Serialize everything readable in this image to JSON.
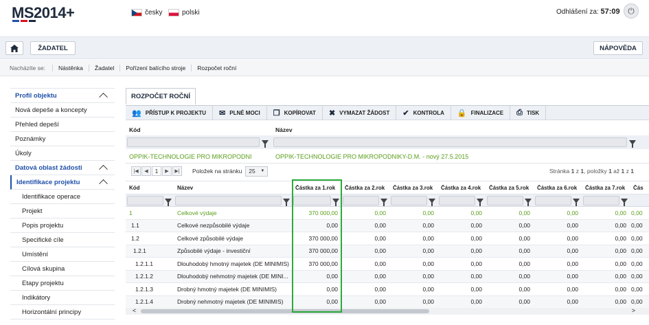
{
  "header": {
    "logo_text": "MS2014+",
    "lang_cz": "česky",
    "lang_pl": "polski",
    "logout_label": "Odhlášení za:",
    "logout_time": "57:09"
  },
  "nav": {
    "home_icon": "home-icon",
    "applicant_button": "ŽADATEL",
    "help_button": "NÁPOVĚDA"
  },
  "breadcrumb": {
    "label": "Nacházíte se:",
    "items": [
      "Nástěnka",
      "Žadatel",
      "Pořízení balícího stroje",
      "Rozpočet roční"
    ]
  },
  "sidebar": {
    "items": [
      {
        "label": "Profil objektu",
        "type": "head"
      },
      {
        "label": "Nová depeše a koncepty",
        "type": "item"
      },
      {
        "label": "Přehled depeší",
        "type": "item"
      },
      {
        "label": "Poznámky",
        "type": "item"
      },
      {
        "label": "Úkoly",
        "type": "item"
      },
      {
        "label": "Datová oblast žádosti",
        "type": "head"
      },
      {
        "label": "Identifikace projektu",
        "type": "head"
      },
      {
        "label": "Identifikace operace",
        "type": "sub"
      },
      {
        "label": "Projekt",
        "type": "sub"
      },
      {
        "label": "Popis projektu",
        "type": "sub"
      },
      {
        "label": "Specifické cíle",
        "type": "sub"
      },
      {
        "label": "Umístění",
        "type": "sub"
      },
      {
        "label": "Cílová skupina",
        "type": "sub"
      },
      {
        "label": "Etapy projektu",
        "type": "sub"
      },
      {
        "label": "Indikátory",
        "type": "sub"
      },
      {
        "label": "Horizontální principy",
        "type": "sub"
      }
    ]
  },
  "main": {
    "tab_label": "ROZPOČET ROČNÍ",
    "toolbar": [
      {
        "label": "PŘÍSTUP K PROJEKTU",
        "icon": "users-icon"
      },
      {
        "label": "PLNÉ MOCI",
        "icon": "mail-icon"
      },
      {
        "label": "KOPÍROVAT",
        "icon": "copy-icon"
      },
      {
        "label": "VYMAZAT ŽÁDOST",
        "icon": "close-icon"
      },
      {
        "label": "KONTROLA",
        "icon": "check-icon"
      },
      {
        "label": "FINALIZACE",
        "icon": "lock-icon"
      },
      {
        "label": "TISK",
        "icon": "print-icon"
      }
    ],
    "grid1": {
      "col_kod": "Kód",
      "col_nazev": "Název",
      "row_kod": "OPPIK-TECHNOLOGIE PRO MIKROPODNI",
      "row_nazev": "OPPIK-TECHNOLOGIE PRO MIKROPODNIKY-D.M. - nový 27.5.2015"
    },
    "pager": {
      "page": "1",
      "per_page_label": "Položek na stránku",
      "per_page": "25",
      "status_page_label": "Stránka",
      "status_page": "1",
      "status_of": "z",
      "status_page_total": "1",
      "status_items_label": "položky",
      "status_items_from": "1",
      "status_items_to_label": "až",
      "status_items_to": "1",
      "status_total_of": "z",
      "status_items_total": "1"
    },
    "table": {
      "columns": [
        "Kód",
        "Název",
        "Částka za 1.rok",
        "Částka za 2.rok",
        "Částka za 3.rok",
        "Částka za 4.rok",
        "Částka za 5.rok",
        "Částka za 6.rok",
        "Částka za 7.rok",
        "Čás"
      ],
      "rows": [
        {
          "kod": "1",
          "nazev": "Celkové výdaje",
          "vals": [
            "370 000,00",
            "0,00",
            "0,00",
            "0,00",
            "0,00",
            "0,00",
            "0,00",
            "0,00"
          ],
          "green": true
        },
        {
          "kod": "1.1",
          "nazev": "Celkové nezpůsobilé výdaje",
          "vals": [
            "0,00",
            "0,00",
            "0,00",
            "0,00",
            "0,00",
            "0,00",
            "0,00",
            "0,00"
          ]
        },
        {
          "kod": "1.2",
          "nazev": "Celkové způsobilé výdaje",
          "vals": [
            "370 000,00",
            "0,00",
            "0,00",
            "0,00",
            "0,00",
            "0,00",
            "0,00",
            "0,00"
          ]
        },
        {
          "kod": "1.2.1",
          "nazev": "Způsobilé výdaje - investiční",
          "vals": [
            "370 000,00",
            "0,00",
            "0,00",
            "0,00",
            "0,00",
            "0,00",
            "0,00",
            "0,00"
          ]
        },
        {
          "kod": "1.2.1.1",
          "nazev": "Dlouhodobý hmotný majetek (DE MINIMIS)",
          "vals": [
            "370 000,00",
            "0,00",
            "0,00",
            "0,00",
            "0,00",
            "0,00",
            "0,00",
            "0,00"
          ]
        },
        {
          "kod": "1.2.1.2",
          "nazev": "Dlouhodobý nehmotný majetek (DE MINI...",
          "vals": [
            "0,00",
            "0,00",
            "0,00",
            "0,00",
            "0,00",
            "0,00",
            "0,00",
            "0,00"
          ]
        },
        {
          "kod": "1.2.1.3",
          "nazev": "Drobný hmotný majetek (DE MINIMIS)",
          "vals": [
            "0,00",
            "0,00",
            "0,00",
            "0,00",
            "0,00",
            "0,00",
            "0,00",
            "0,00"
          ]
        },
        {
          "kod": "1.2.1.4",
          "nazev": "Drobný nehmotný majetek (DE MINIMIS)",
          "vals": [
            "0,00",
            "0,00",
            "0,00",
            "0,00",
            "0,00",
            "0,00",
            "0,00",
            "0,00"
          ]
        }
      ]
    }
  },
  "colors": {
    "brand_dark": "#1e2a3c",
    "accent_blue": "#1e4fa8",
    "green_text": "#5a9e1b",
    "highlight_green": "#2bab3a"
  }
}
